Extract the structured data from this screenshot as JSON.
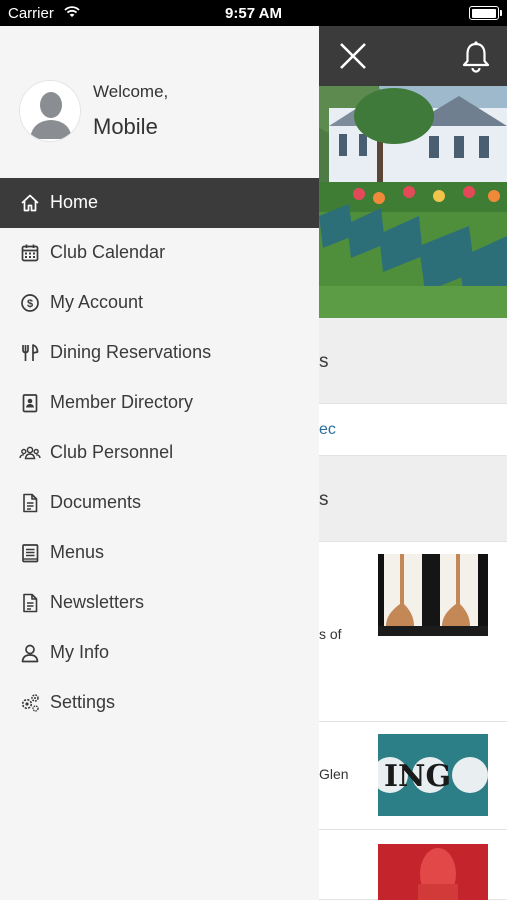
{
  "status_bar": {
    "carrier": "Carrier",
    "time": "9:57 AM",
    "battery_level": 1.0
  },
  "drawer": {
    "welcome": "Welcome,",
    "username": "Mobile",
    "items": [
      {
        "label": "Home",
        "icon": "home-icon",
        "active": true
      },
      {
        "label": "Club Calendar",
        "icon": "calendar-icon",
        "active": false
      },
      {
        "label": "My Account",
        "icon": "dollar-icon",
        "active": false
      },
      {
        "label": "Dining Reservations",
        "icon": "utensils-icon",
        "active": false
      },
      {
        "label": "Member Directory",
        "icon": "contact-book-icon",
        "active": false
      },
      {
        "label": "Club Personnel",
        "icon": "people-icon",
        "active": false
      },
      {
        "label": "Documents",
        "icon": "document-icon",
        "active": false
      },
      {
        "label": "Menus",
        "icon": "menu-book-icon",
        "active": false
      },
      {
        "label": "Newsletters",
        "icon": "newsletter-icon",
        "active": false
      },
      {
        "label": "My Info",
        "icon": "user-icon",
        "active": false
      },
      {
        "label": "Settings",
        "icon": "gears-icon",
        "active": false
      }
    ]
  },
  "background": {
    "section_1_fragment": "s",
    "link_fragment": "ec",
    "section_2_fragment": "s",
    "news": [
      {
        "snippet": "s of"
      },
      {
        "snippet": "Glen",
        "thumb_text": "ING"
      },
      {
        "snippet": ""
      }
    ]
  },
  "colors": {
    "active_bg": "#3b3b3b",
    "drawer_bg": "#f5f5f5",
    "link": "#2a6e9c",
    "topbar": "#3b3b3b"
  }
}
